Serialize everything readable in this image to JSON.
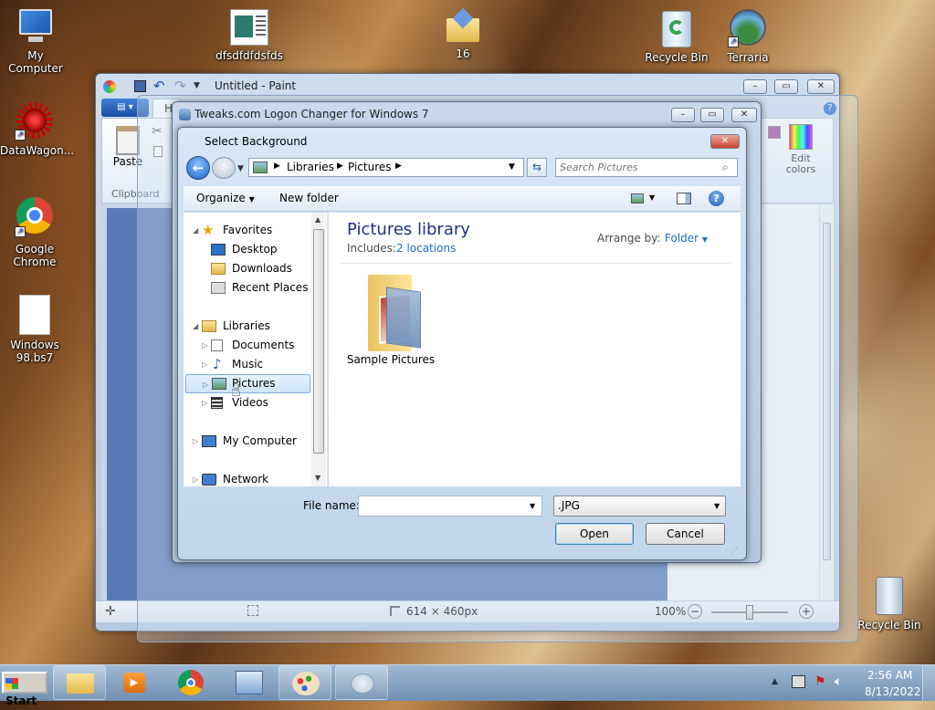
{
  "desktop": {
    "icons": [
      {
        "label": "My Computer"
      },
      {
        "label": "DataWagon..."
      },
      {
        "label": "Google Chrome"
      },
      {
        "label": "Windows 98.bs7"
      },
      {
        "label": "dfsdfdfdsfds"
      },
      {
        "label": "16"
      },
      {
        "label": "Recycle Bin"
      },
      {
        "label": "Terraria"
      },
      {
        "label": "Recycle Bin"
      }
    ]
  },
  "paint": {
    "title": "Untitled - Paint",
    "tab_home": "H",
    "paste_label": "Paste",
    "clipboard_label": "Clipboard",
    "edit_colors_label": "Edit colors",
    "status_size": "614 × 460px",
    "zoom": "100%"
  },
  "tweaks": {
    "title": "Tweaks.com Logon Changer for Windows 7"
  },
  "dialog": {
    "title": "Select Background",
    "breadcrumb": [
      "Libraries",
      "Pictures"
    ],
    "search_placeholder": "Search Pictures",
    "organize_label": "Organize",
    "new_folder_label": "New folder",
    "nav": {
      "favorites": "Favorites",
      "desktop": "Desktop",
      "downloads": "Downloads",
      "recent_places": "Recent Places",
      "libraries": "Libraries",
      "documents": "Documents",
      "music": "Music",
      "pictures": "Pictures",
      "videos": "Videos",
      "my_computer": "My Computer",
      "network": "Network"
    },
    "library_title": "Pictures library",
    "includes_label": "Includes:",
    "locations_link": "2 locations",
    "arrange_by_label": "Arrange by:",
    "arrange_by_value": "Folder",
    "items": [
      {
        "label": "Sample Pictures"
      }
    ],
    "file_name_label": "File name:",
    "file_name_value": "",
    "file_type_value": ".JPG",
    "open_label": "Open",
    "cancel_label": "Cancel"
  },
  "taskbar": {
    "start_label": "Start",
    "time": "2:56 AM",
    "date": "8/13/2022"
  }
}
